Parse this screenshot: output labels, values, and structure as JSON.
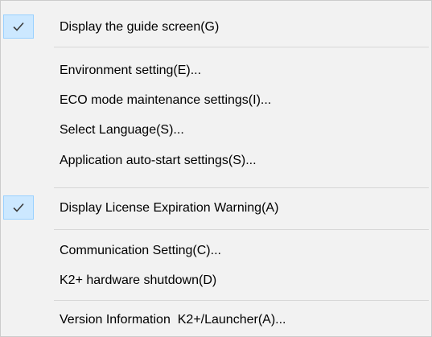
{
  "menu": {
    "items": [
      {
        "label": "Display the guide screen(G)",
        "checked": true
      },
      {
        "label": "Environment setting(E)...",
        "checked": false
      },
      {
        "label": "ECO mode maintenance settings(I)...",
        "checked": false
      },
      {
        "label": "Select Language(S)...",
        "checked": false
      },
      {
        "label": "Application auto-start settings(S)...",
        "checked": false
      },
      {
        "label": "Display License Expiration Warning(A)",
        "checked": true
      },
      {
        "label": "Communication Setting(C)...",
        "checked": false
      },
      {
        "label": "K2+ hardware shutdown(D)",
        "checked": false
      },
      {
        "label": "Version Information  K2+/Launcher(A)...",
        "checked": false
      }
    ]
  },
  "colors": {
    "menu_background": "#f2f2f2",
    "check_highlight": "#cce8ff",
    "check_border": "#99d1ff",
    "separator": "#d7d7d7"
  },
  "icons": {
    "check": "check-icon"
  }
}
